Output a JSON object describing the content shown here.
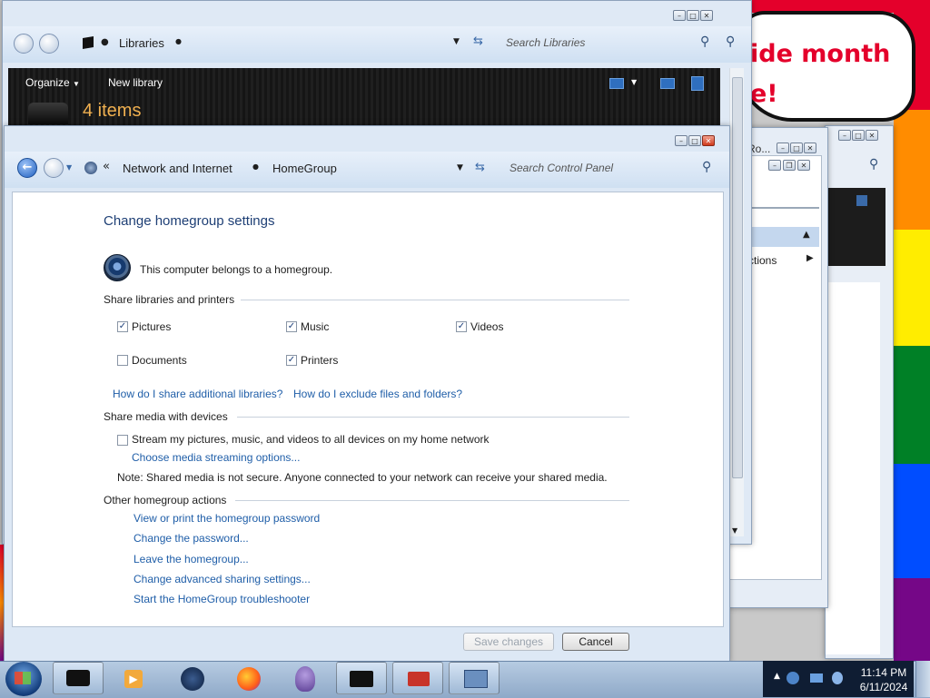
{
  "desktop": {
    "banner_text_line1": "ide month",
    "banner_text_line2": "e!",
    "rainbow": [
      "#e4002b",
      "#ff8c00",
      "#ffed00",
      "#008026",
      "#004dff",
      "#750787"
    ]
  },
  "libraries_window": {
    "breadcrumb": "Libraries",
    "search_placeholder": "Search Libraries",
    "toolbar": {
      "organize": "Organize",
      "new_library": "New library"
    },
    "count_text": "4 items"
  },
  "background_window": {
    "title_fragment": "Ro...",
    "menu_item_1": "t",
    "menu_item_2": "ctions"
  },
  "homegroup_window": {
    "breadcrumb": [
      "Network and Internet",
      "HomeGroup"
    ],
    "breadcrumb_prefix": "«",
    "search_placeholder": "Search Control Panel",
    "heading": "Change homegroup settings",
    "membership_text": "This computer belongs to a homegroup.",
    "sections": {
      "share_libraries": "Share libraries and printers",
      "share_media": "Share media with devices",
      "other_actions": "Other homegroup actions"
    },
    "libraries": [
      {
        "label": "Pictures",
        "checked": true
      },
      {
        "label": "Music",
        "checked": true
      },
      {
        "label": "Videos",
        "checked": true
      },
      {
        "label": "Documents",
        "checked": false
      },
      {
        "label": "Printers",
        "checked": true
      }
    ],
    "help_links": [
      "How do I share additional libraries?",
      "How do I exclude files and folders?"
    ],
    "stream_label": "Stream my pictures, music, and videos to all devices on my home network",
    "stream_checked": false,
    "streaming_options_link": "Choose media streaming options...",
    "note": "Note: Shared media is not secure. Anyone connected to your network can receive your shared media.",
    "actions": [
      "View or print the homegroup password",
      "Change the password...",
      "Leave the homegroup...",
      "Change advanced sharing settings...",
      "Start the HomeGroup troubleshooter"
    ],
    "buttons": {
      "save": "Save changes",
      "cancel": "Cancel"
    }
  },
  "taskbar": {
    "time": "11:14 PM",
    "date": "6/11/2024",
    "apps": [
      "start-orb-icon",
      "libraries-app-icon",
      "media-player-icon",
      "steam-icon",
      "firefox-icon",
      "pidgin-icon",
      "screen-app-icon",
      "toolbox-icon",
      "control-panel-icon"
    ]
  }
}
